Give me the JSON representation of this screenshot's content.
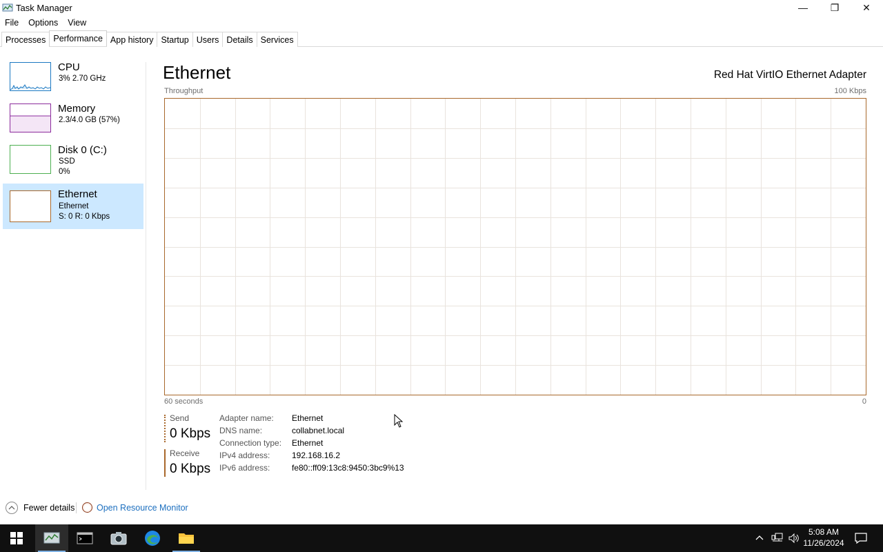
{
  "window": {
    "title": "Task Manager",
    "minimize_glyph": "—",
    "maximize_glyph": "❐",
    "close_glyph": "✕"
  },
  "menu": [
    "File",
    "Options",
    "View"
  ],
  "tabs": [
    "Processes",
    "Performance",
    "App history",
    "Startup",
    "Users",
    "Details",
    "Services"
  ],
  "active_tab": "Performance",
  "sidebar": {
    "items": [
      {
        "title": "CPU",
        "line1": "3%  2.70 GHz",
        "line2": "",
        "color": "#1a78c2"
      },
      {
        "title": "Memory",
        "line1": "2.3/4.0 GB (57%)",
        "line2": "",
        "color": "#8b2a9c"
      },
      {
        "title": "Disk 0 (C:)",
        "line1": "SSD",
        "line2": "0%",
        "color": "#4caf50"
      },
      {
        "title": "Ethernet",
        "line1": "Ethernet",
        "line2": "S: 0  R: 0 Kbps",
        "color": "#a8672a"
      }
    ],
    "selected_index": 3,
    "cpu_usage_percent": 3,
    "memory_usage_percent": 57
  },
  "main": {
    "title": "Ethernet",
    "adapter": "Red Hat VirtIO Ethernet Adapter",
    "graph_label": "Throughput",
    "graph_max": "100 Kbps",
    "graph_time": "60 seconds",
    "graph_min": "0",
    "graph_color": "#a8672a"
  },
  "stats": {
    "send_label": "Send",
    "send_value": "0 Kbps",
    "receive_label": "Receive",
    "receive_value": "0 Kbps"
  },
  "info": [
    {
      "key": "Adapter name:",
      "value": "Ethernet"
    },
    {
      "key": "DNS name:",
      "value": "collabnet.local"
    },
    {
      "key": "Connection type:",
      "value": "Ethernet"
    },
    {
      "key": "IPv4 address:",
      "value": "192.168.16.2"
    },
    {
      "key": "IPv6 address:",
      "value": "fe80::ff09:13c8:9450:3bc9%13"
    }
  ],
  "footer": {
    "fewer_details": "Fewer details",
    "open_resource_monitor": "Open Resource Monitor"
  },
  "taskbar": {
    "apps": [
      "start-icon",
      "task-manager-icon",
      "terminal-icon",
      "camera-icon",
      "edge-icon",
      "file-explorer-icon"
    ],
    "time": "5:08 AM",
    "date": "11/26/2024"
  }
}
